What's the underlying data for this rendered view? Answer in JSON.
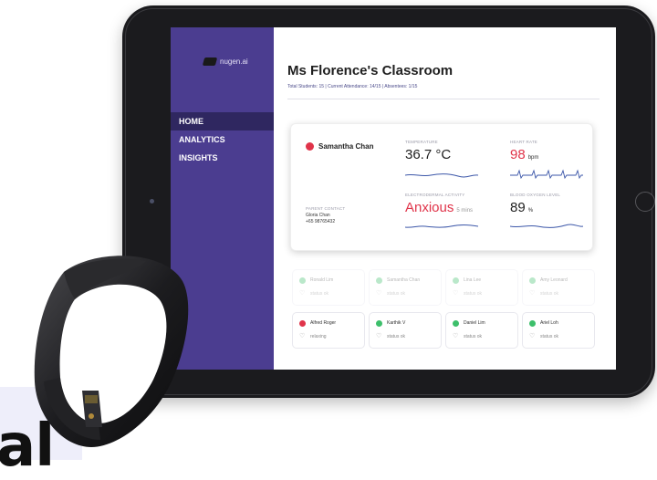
{
  "background": {
    "text": "al"
  },
  "sidebar": {
    "logo_text": "nugen.ai",
    "items": [
      {
        "label": "HOME",
        "active": true
      },
      {
        "label": "ANALYTICS",
        "active": false
      },
      {
        "label": "INSIGHTS",
        "active": false
      }
    ]
  },
  "header": {
    "title": "Ms Florence's Classroom",
    "subtitle": "Total Students: 15  |  Current Attendance: 14/15  |  Absentees: 1/15"
  },
  "student_card": {
    "name": "Samantha Chan",
    "status_color": "#e0344a",
    "parent_contact_label": "PARENT CONTACT",
    "parent_name": "Gloria Chan",
    "parent_phone": "+65 98765432",
    "temperature": {
      "label": "TEMPERATURE",
      "value": "36.7 °C"
    },
    "heart_rate": {
      "label": "HEART RATE",
      "value": "98",
      "unit": "bpm",
      "color": "#e0344a"
    },
    "eda": {
      "label": "ELECTRODERMAL ACTIVITY",
      "value": "Anxious",
      "unit": "5 mins",
      "color": "#e0344a"
    },
    "oxygen": {
      "label": "BLOOD OXYGEN LEVEL",
      "value": "89",
      "unit": "%"
    }
  },
  "students": [
    {
      "name": "Ronald Lim",
      "status": "status ok",
      "color": "#3dbf6b",
      "faded": true
    },
    {
      "name": "Samantha Chan",
      "status": "status ok",
      "color": "#3dbf6b",
      "faded": true
    },
    {
      "name": "Lina Lee",
      "status": "status ok",
      "color": "#3dbf6b",
      "faded": true
    },
    {
      "name": "Amy Leonard",
      "status": "status ok",
      "color": "#3dbf6b",
      "faded": true
    },
    {
      "name": "Alfred Roger",
      "status": "relaxing",
      "color": "#e0344a",
      "faded": false
    },
    {
      "name": "Karthik V",
      "status": "status ok",
      "color": "#3dbf6b",
      "faded": false
    },
    {
      "name": "Daniel Lim",
      "status": "status ok",
      "color": "#3dbf6b",
      "faded": false
    },
    {
      "name": "Ariel Loh",
      "status": "status ok",
      "color": "#3dbf6b",
      "faded": false
    }
  ],
  "icons": {
    "tile_icon": "heart-icon",
    "device": "wearable-ring-band"
  },
  "colors": {
    "sidebar": "#4b3d90",
    "active_nav": "#2f2760",
    "alert": "#e0344a",
    "ok": "#3dbf6b",
    "wave": "#3b56a8"
  }
}
